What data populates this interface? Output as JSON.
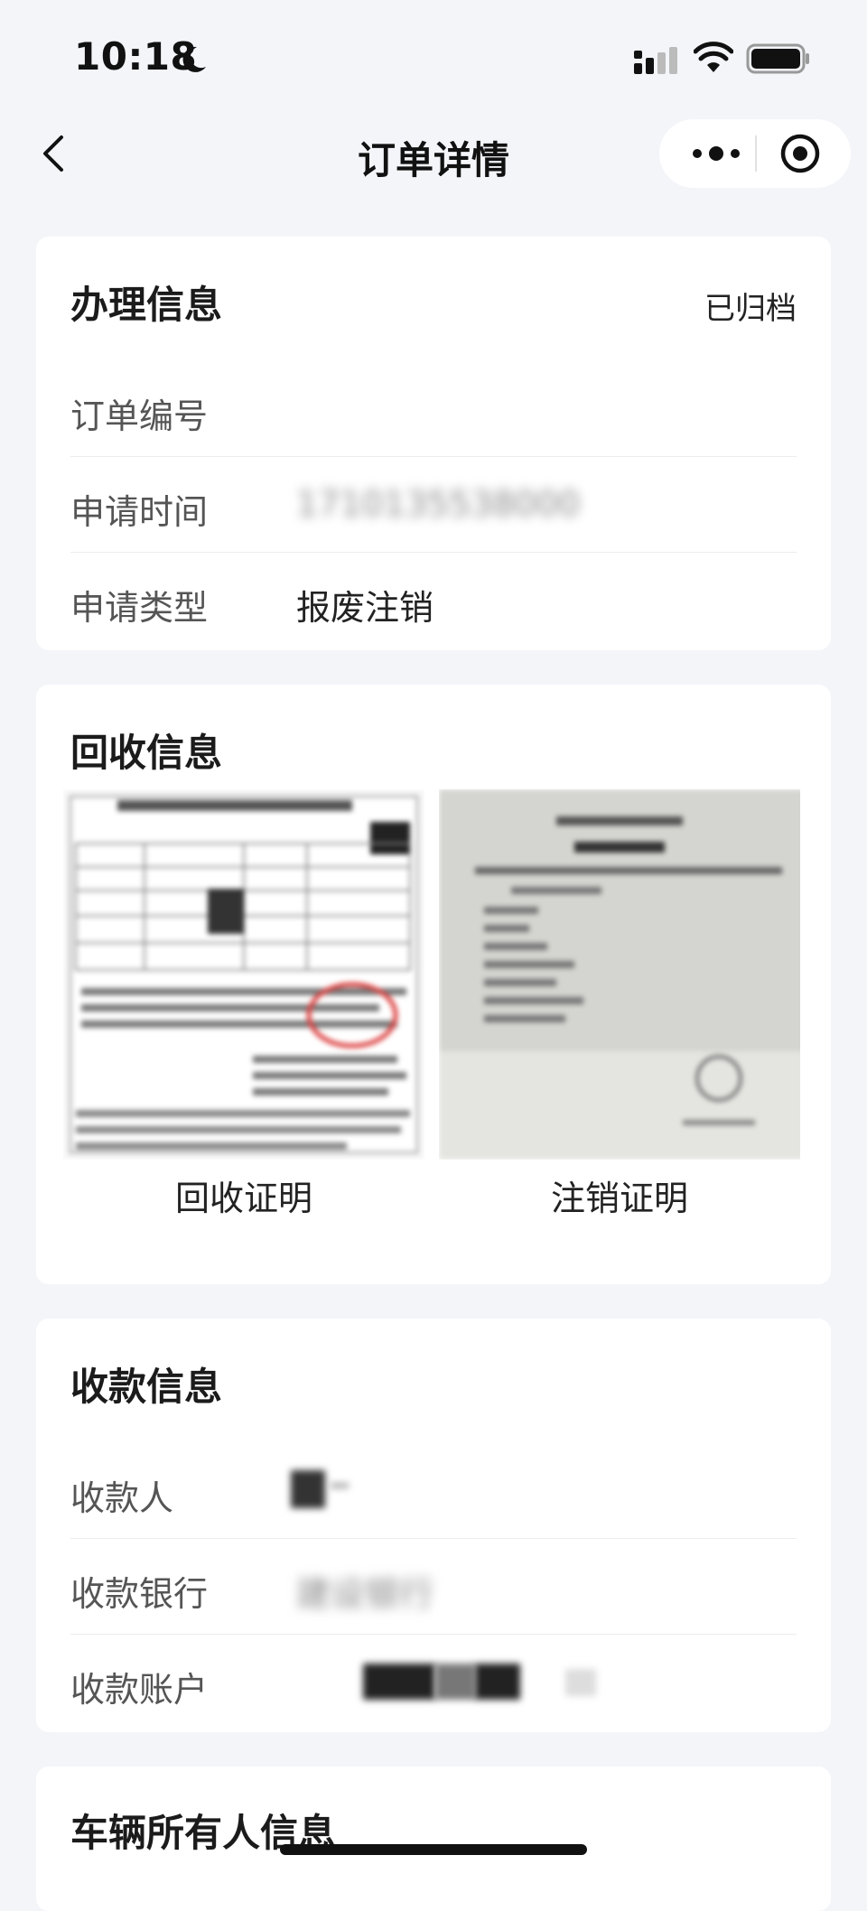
{
  "status_bar": {
    "time": "10:18",
    "icons": [
      "moon-icon",
      "signal-icon",
      "wifi-icon",
      "battery-icon"
    ]
  },
  "nav": {
    "title": "订单详情",
    "back_icon": "chevron-left-icon",
    "more_icon": "more-dots-icon",
    "close_icon": "target-circle-icon"
  },
  "handling_info": {
    "title": "办理信息",
    "status": "已归档",
    "rows": [
      {
        "label": "订单编号",
        "value": ""
      },
      {
        "label": "申请时间",
        "value": "1710135538000"
      },
      {
        "label": "申请类型",
        "value": "报废注销"
      }
    ]
  },
  "recycle_info": {
    "title": "回收信息",
    "documents": [
      {
        "caption": "回收证明"
      },
      {
        "caption": "注销证明"
      }
    ]
  },
  "payment_info": {
    "title": "收款信息",
    "rows": [
      {
        "label": "收款人",
        "value": ""
      },
      {
        "label": "收款银行",
        "value": "建设银行"
      },
      {
        "label": "收款账户",
        "value": ""
      }
    ]
  },
  "owner_info": {
    "title": "车辆所有人信息"
  },
  "colors": {
    "background": "#f3f5f9",
    "card": "#ffffff",
    "text_primary": "#222222",
    "text_label": "#555555"
  }
}
